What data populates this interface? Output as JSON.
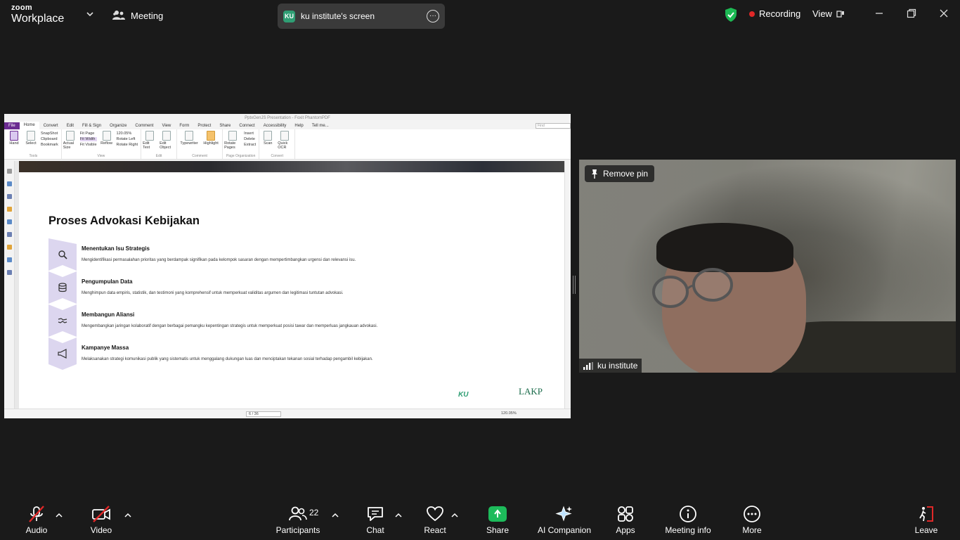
{
  "topbar": {
    "brand_top": "zoom",
    "brand_bottom": "Workplace",
    "meeting_label": "Meeting",
    "screen_label": "ku institute's screen",
    "screen_badge": "KU",
    "recording_label": "Recording",
    "view_label": "View"
  },
  "pdf": {
    "window_title": "PptxGenJS Presentation - Foxit PhantomPDF",
    "menus": [
      "File",
      "Home",
      "Convert",
      "Edit",
      "Fill & Sign",
      "Organize",
      "Comment",
      "View",
      "Form",
      "Protect",
      "Share",
      "Connect",
      "Accessibility",
      "Help",
      "Tell me..."
    ],
    "find_placeholder": "Find",
    "ribbon": {
      "hand": "Hand",
      "select": "Select",
      "snapshot": "SnapShot",
      "clipboard": "Clipboard",
      "bookmark": "Bookmark",
      "actual_size": "Actual Size",
      "fit_page": "Fit Page",
      "fit_width": "Fit Width",
      "fit_visible": "Fit Visible",
      "reflow": "Reflow",
      "zoom": "120.05%",
      "rotate_left": "Rotate Left",
      "rotate_right": "Rotate Right",
      "edit_text": "Edit Text",
      "edit_object": "Edit Object",
      "typewriter": "Typewriter",
      "highlight": "Highlight",
      "rotate_pages": "Rotate Pages",
      "insert": "Insert",
      "delete": "Delete",
      "extract": "Extract",
      "scan": "Scan",
      "quick_ocr": "Quick OCR",
      "groups": {
        "tools": "Tools",
        "view": "View",
        "edit": "Edit",
        "comment": "Comment",
        "page_org": "Page Organization",
        "convert": "Convert"
      }
    },
    "slide": {
      "title": "Proses Advokasi Kebijakan",
      "steps": [
        {
          "heading": "Menentukan Isu Strategis",
          "desc": "Mengidentifikasi permasalahan prioritas yang berdampak signifikan pada kelompok sasaran dengan mempertimbangkan urgensi dan relevansi isu.",
          "icon": "magnifier-icon"
        },
        {
          "heading": "Pengumpulan Data",
          "desc": "Menghimpun data empiris, statistik, dan testimoni yang komprehensif untuk memperkuat validitas argumen dan legitimasi tuntutan advokasi.",
          "icon": "database-icon"
        },
        {
          "heading": "Membangun Aliansi",
          "desc": "Mengembangkan jaringan kolaboratif dengan berbagai pemangku kepentingan strategis untuk memperkuat posisi tawar dan memperluas jangkauan advokasi.",
          "icon": "handshake-icon"
        },
        {
          "heading": "Kampanye Massa",
          "desc": "Melaksanakan strategi komunikasi publik yang sistematis untuk menggalang dukungan luas dan menciptakan tekanan sosial terhadap pengambil kebijakan.",
          "icon": "megaphone-icon"
        }
      ],
      "logo_left": "KU",
      "logo_right": "LAKP"
    },
    "status": {
      "page": "6 / 36",
      "zoom": "120.05%"
    }
  },
  "video": {
    "remove_pin": "Remove pin",
    "name": "ku institute"
  },
  "toolbar": {
    "audio": "Audio",
    "video": "Video",
    "participants": "Participants",
    "participants_count": "22",
    "chat": "Chat",
    "react": "React",
    "share": "Share",
    "ai": "AI Companion",
    "apps": "Apps",
    "info": "Meeting info",
    "more": "More",
    "leave": "Leave"
  },
  "colors": {
    "share_green": "#1dbb5b",
    "rec_red": "#e02828",
    "shield_green": "#1db954",
    "slide_chevron": "#dcd6ef",
    "accent_purple": "#6b2c91"
  }
}
